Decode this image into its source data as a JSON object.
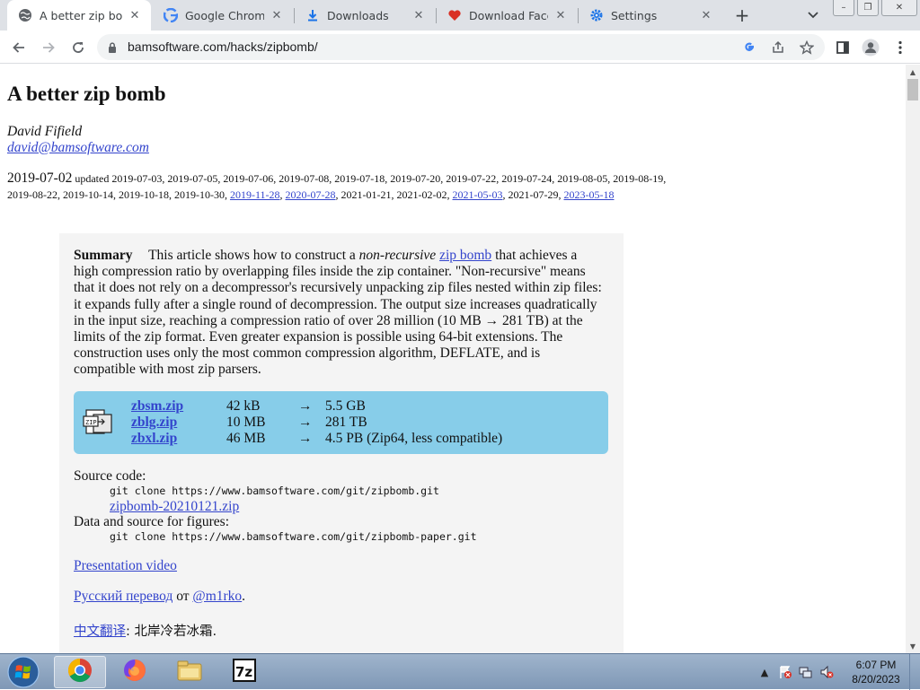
{
  "browser": {
    "tabs": [
      {
        "label": "A better zip bomb",
        "active": true,
        "icon": "globe-icon"
      },
      {
        "label": "Google Chrome b",
        "active": false,
        "icon": "google-icon"
      },
      {
        "label": "Downloads",
        "active": false,
        "icon": "download-icon"
      },
      {
        "label": "Download Facebo",
        "active": false,
        "icon": "heart-icon"
      },
      {
        "label": "Settings",
        "active": false,
        "icon": "gear-icon"
      }
    ],
    "new_tab_label": "+",
    "url": "bamsoftware.com/hacks/zipbomb/"
  },
  "page": {
    "title": "A better zip bomb",
    "author": "David Fifield",
    "email": "david@bamsoftware.com",
    "published": "2019-07-02",
    "updated_label": "updated",
    "updates_plain_1": "2019-07-03, 2019-07-05, 2019-07-06, 2019-07-08, 2019-07-18, 2019-07-20, 2019-07-22, 2019-07-24, 2019-08-05, 2019-08-19, 2019-08-22, 2019-10-14, 2019-10-18, 2019-10-30,",
    "update_link_1": "2019-11-28",
    "update_link_2": "2020-07-28",
    "updates_plain_2": "2021-01-21, 2021-02-02,",
    "update_link_3": "2021-05-03",
    "updates_plain_3": "2021-07-29,",
    "update_link_4": "2023-05-18",
    "summary": {
      "label": "Summary",
      "text_1": "This article shows how to construct a",
      "emph": "non-recursive",
      "link": "zip bomb",
      "text_2": "that achieves a high compression ratio by overlapping files inside the zip container. \"Non-recursive\" means that it does not rely on a decompressor's recursively unpacking zip files nested within zip files: it expands fully after a single round of decompression. The output size increases quadratically in the input size, reaching a compression ratio of over 28 million (10 MB → 281 TB) at the limits of the zip format. Even greater expansion is possible using 64-bit extensions. The construction uses only the most common compression algorithm, DEFLATE, and is compatible with most zip parsers."
    },
    "downloads": [
      {
        "file": "zbsm.zip",
        "size": "42 kB",
        "arrow": "→",
        "result": "5.5 GB"
      },
      {
        "file": "zblg.zip",
        "size": "10 MB",
        "arrow": "→",
        "result": "281 TB"
      },
      {
        "file": "zbxl.zip",
        "size": "46 MB",
        "arrow": "→",
        "result": "4.5 PB (Zip64, less compatible)"
      }
    ],
    "source": {
      "label": "Source code:",
      "cmd": "git clone https://www.bamsoftware.com/git/zipbomb.git",
      "zip_link": "zipbomb-20210121.zip",
      "figures_label": "Data and source for figures:",
      "figures_cmd": "git clone https://www.bamsoftware.com/git/zipbomb-paper.git"
    },
    "presentation_link": "Presentation video",
    "russian_link": "Русский перевод",
    "russian_from": "от",
    "russian_author": "@m1rko",
    "chinese_link": "中文翻译",
    "chinese_text": ": 北岸冷若冰霜."
  },
  "taskbar": {
    "apps": [
      "chrome-icon",
      "firefox-icon",
      "file-explorer-icon",
      "7zip-icon"
    ],
    "time": "6:07 PM",
    "date": "8/20/2023"
  }
}
